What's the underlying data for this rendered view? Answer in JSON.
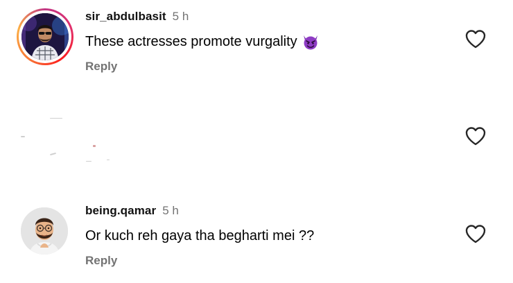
{
  "comments": [
    {
      "username": "sir_abdulbasit",
      "time": "5 h",
      "text": "These actresses promote vurgality",
      "emoji_icon": "smiling-devil-emoji-icon",
      "reply_label": "Reply",
      "avatar_story_ring": true
    },
    {
      "username": "being.qamar",
      "time": "5 h",
      "text": "Or kuch reh gaya tha begharti mei ??",
      "reply_label": "Reply",
      "avatar_story_ring": false
    }
  ],
  "icons": {
    "like": "heart-outline-icon"
  },
  "colors": {
    "username": "#111111",
    "secondary_text": "#737373",
    "story_ring": "#e1306c",
    "devil_emoji": "#7b2fb0"
  }
}
